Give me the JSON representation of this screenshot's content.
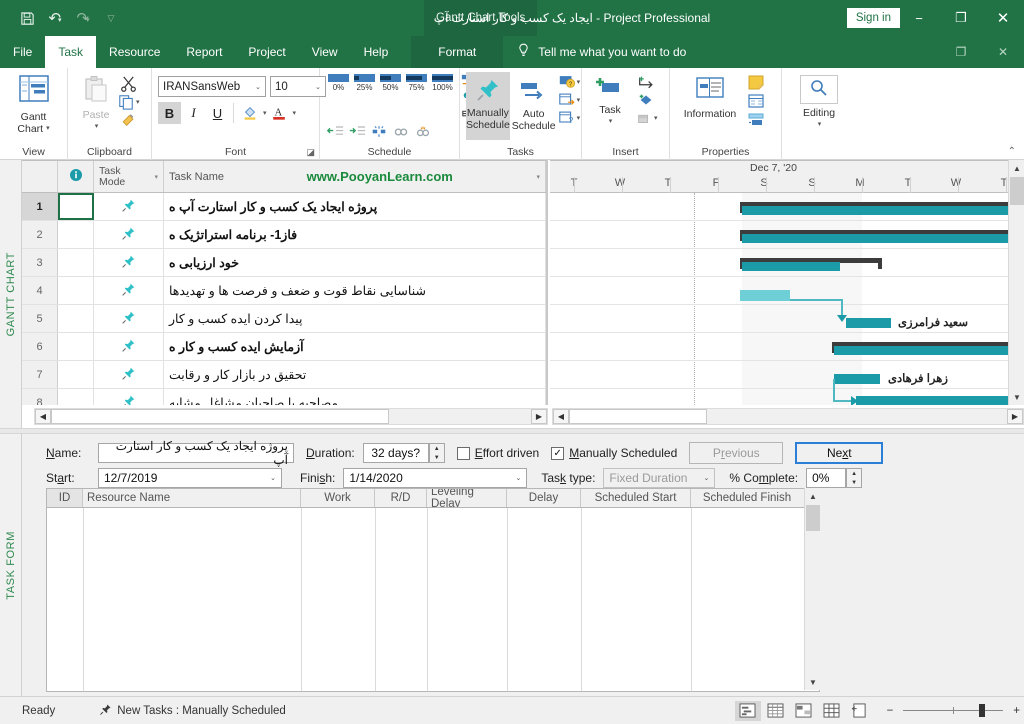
{
  "window": {
    "title": "ایجاد یک کسب و کار استارت آپ  -  Project Professional",
    "context_tab": "Gantt Chart Tools",
    "signin": "Sign in",
    "minimize": "−",
    "restore": "❐",
    "close": "✕",
    "accent": "#217346"
  },
  "quick_access": {
    "save": "save-icon",
    "undo": "undo-icon",
    "redo": "redo-icon",
    "customize": "customize-icon"
  },
  "tabs": [
    {
      "label": "File",
      "active": false
    },
    {
      "label": "Task",
      "active": true
    },
    {
      "label": "Resource",
      "active": false
    },
    {
      "label": "Report",
      "active": false
    },
    {
      "label": "Project",
      "active": false
    },
    {
      "label": "View",
      "active": false
    },
    {
      "label": "Help",
      "active": false
    },
    {
      "label": "Format",
      "active": false,
      "contextual": true
    }
  ],
  "tellme": {
    "placeholder": "Tell me what you want to do",
    "icon": "lightbulb-icon"
  },
  "ribbon": {
    "groups": [
      {
        "name": "View",
        "label": "View"
      },
      {
        "name": "Clipboard",
        "label": "Clipboard"
      },
      {
        "name": "Font",
        "label": "Font"
      },
      {
        "name": "Schedule",
        "label": "Schedule"
      },
      {
        "name": "Tasks",
        "label": "Tasks"
      },
      {
        "name": "Insert",
        "label": "Insert"
      },
      {
        "name": "Properties",
        "label": "Properties"
      },
      {
        "name": "Editing",
        "label": ""
      }
    ],
    "gantt_chart": "Gantt\nChart",
    "gantt_chart_l1": "Gantt",
    "gantt_chart_l2": "Chart",
    "paste": "Paste",
    "cut": "cut-icon",
    "copy": "copy-icon",
    "format_painter": "format-painter-icon",
    "font_name": "IRANSansWeb",
    "font_size": "10",
    "bold": "B",
    "italic": "I",
    "underline": "U",
    "fill_color": "fill-color-icon",
    "font_color": "font-color-icon",
    "percents": [
      "0%",
      "25%",
      "50%",
      "75%",
      "100%"
    ],
    "manually_schedule_l1": "Manually",
    "manually_schedule_l2": "Schedule",
    "auto_schedule_l1": "Auto",
    "auto_schedule_l2": "Schedule",
    "task": "Task",
    "information": "Information",
    "editing": "Editing"
  },
  "panes": {
    "gantt_label": "GANTT CHART",
    "task_form_label": "TASK FORM"
  },
  "grid": {
    "columns": {
      "id": "",
      "info": "info-icon",
      "mode_l1": "Task",
      "mode_l2": "Mode",
      "name": "Task Name",
      "watermark": "www.PooyanLearn.com"
    },
    "rows": [
      {
        "id": "1",
        "mode": "pin-icon",
        "name": "پروژه ایجاد یک کسب و کار استارت آپ ه",
        "bold": true,
        "selected": true
      },
      {
        "id": "2",
        "mode": "pin-icon",
        "name": "فاز1- برنامه استراتژیک ه",
        "bold": true,
        "selected": false
      },
      {
        "id": "3",
        "mode": "pin-icon",
        "name": "خود ارزیابی ه",
        "bold": true,
        "selected": false
      },
      {
        "id": "4",
        "mode": "pin-icon",
        "name": "شناسایی نقاط قوت و ضعف و فرصت ها و تهدیدها",
        "bold": false,
        "selected": false
      },
      {
        "id": "5",
        "mode": "pin-icon",
        "name": "پیدا کردن ایده کسب و کار",
        "bold": false,
        "selected": false
      },
      {
        "id": "6",
        "mode": "pin-icon",
        "name": "آزمایش ایده کسب و کار ه",
        "bold": true,
        "selected": false
      },
      {
        "id": "7",
        "mode": "pin-icon",
        "name": "تحقیق در بازار کار و رقابت",
        "bold": false,
        "selected": false
      },
      {
        "id": "8",
        "mode": "pin-icon",
        "name": "مصاحبه با صاحبان مشاغل مشابه",
        "bold": false,
        "selected": false
      }
    ]
  },
  "timeline": {
    "week_label": "Dec 7, '20",
    "days": [
      "T",
      "W",
      "T",
      "F",
      "S",
      "S",
      "M",
      "T",
      "W",
      "T"
    ],
    "resource_labels": [
      {
        "text": "سعید فرامرزی",
        "row": 4
      },
      {
        "text": "زهرا فرهادی",
        "row": 6
      }
    ]
  },
  "task_form": {
    "name_label": "Name:",
    "name_value": "پروژه ایجاد یک کسب و کار استارت آپ",
    "duration_label": "Duration:",
    "duration_value": "32 days?",
    "effort_driven_label": "Effort driven",
    "effort_driven_checked": false,
    "manually_scheduled_label": "Manually Scheduled",
    "manually_scheduled_checked": true,
    "previous_label": "Previous",
    "next_label": "Next",
    "start_label": "Start:",
    "start_value": "12/7/2019",
    "finish_label": "Finish:",
    "finish_value": "1/14/2020",
    "task_type_label": "Task type:",
    "task_type_value": "Fixed Duration",
    "percent_complete_label": "% Complete:",
    "percent_complete_value": "0%",
    "resource_columns": [
      "ID",
      "Resource Name",
      "Work",
      "R/D",
      "Leveling Delay",
      "Delay",
      "Scheduled Start",
      "Scheduled Finish"
    ]
  },
  "status_bar": {
    "ready": "Ready",
    "new_tasks": "New Tasks : Manually Scheduled",
    "new_tasks_icon": "pin-icon",
    "views": [
      "gantt-view-icon",
      "task-usage-icon",
      "team-planner-icon",
      "resource-sheet-icon",
      "report-icon"
    ],
    "zoom_out": "−",
    "zoom_in": "+"
  }
}
